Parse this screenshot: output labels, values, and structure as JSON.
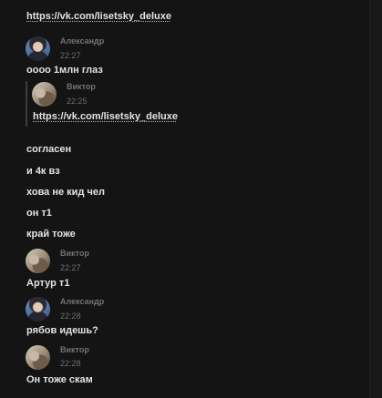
{
  "messages": {
    "top_link": "https://vk.com/lisetsky_deluxe",
    "m1": {
      "author": "Александр",
      "time": "22:27",
      "text": "оооо 1млн глаз"
    },
    "quote": {
      "author": "Виктор",
      "time": "22:25",
      "link": "https://vk.com/lisetsky_deluxe"
    },
    "lines": [
      "согласен",
      "и 4к вз",
      "хова не кид чел",
      "он т1",
      "край тоже"
    ],
    "m2": {
      "author": "Виктор",
      "time": "22:27",
      "text": "Артур т1"
    },
    "m3": {
      "author": "Александр",
      "time": "22:28",
      "text": "рябов идешь?"
    },
    "m4": {
      "author": "Виктор",
      "time": "22:28",
      "text": "Он тоже скам"
    }
  }
}
